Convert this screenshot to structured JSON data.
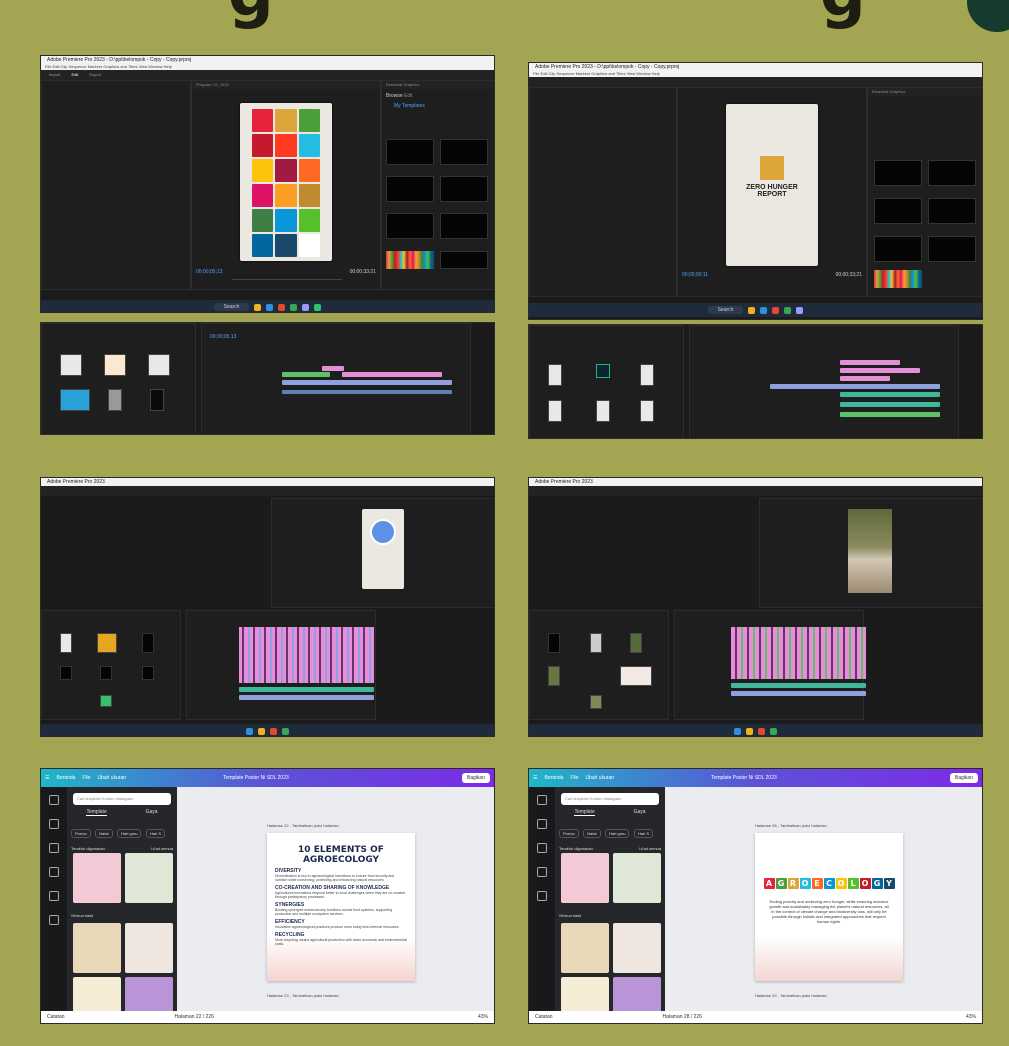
{
  "background": {
    "color": "#a4a552",
    "top_glyph": "g"
  },
  "premiere_top_left": {
    "window_title": "Adobe Premiere Pro 2023 - D:\\ppt\\kelompok - Copy - Copy.prproj",
    "menu": "File  Edit  Clip  Sequence  Markers  Graphics and Titles  View  Window  Help",
    "workspace_tabs": [
      "Import",
      "Edit",
      "Export"
    ],
    "program_label": "Program: 01_SDG",
    "timecode_left": "00;00;05;13",
    "timecode_right": "00;00;33;21",
    "essential_graphics": "Essential Graphics",
    "browse_tab": "Browse",
    "edit_tab": "Edit",
    "my_templates": "My Templates",
    "poster_colors": [
      "#e5243b",
      "#dda63a",
      "#4c9f38",
      "#c5192d",
      "#ff3a21",
      "#26bde2",
      "#fcc30b",
      "#a21942",
      "#fd6925",
      "#dd1367",
      "#fd9d24",
      "#bf8b2e",
      "#3f7e44",
      "#0a97d9",
      "#56c02b",
      "#00689d",
      "#19486a",
      "#ffffff"
    ]
  },
  "premiere_top_right": {
    "window_title": "Adobe Premiere Pro 2023 - D:\\ppt\\kelompok - Copy - Copy.prproj",
    "poster_line1": "ZERO HUNGER",
    "poster_line2": "REPORT",
    "timecode_left": "00;00;00;11",
    "timecode_right": "00;00;33;21",
    "essential_graphics": "Essential Graphics"
  },
  "premiere_mid_left": {
    "window_title": "Adobe Premiere Pro 2023"
  },
  "premiere_mid_right": {
    "window_title": "Adobe Premiere Pro 2023"
  },
  "taskbar": {
    "search": "Search"
  },
  "canva_left": {
    "top_items": [
      "Beranda",
      "File",
      "Ubah ukuran"
    ],
    "doc_title": "Template Poster Ni SDL 2023",
    "present_button": "Bagikan",
    "search_placeholder": "Cari template Konten Instagram",
    "tabs": [
      "Template",
      "Gaya"
    ],
    "chips": [
      "Promo",
      "Natal",
      "Hari guru",
      "Hari S"
    ],
    "section_1": "Terakhir digunakan",
    "section_1_link": "Lihat semua",
    "section_2": "Semua hasil",
    "page_label": "Halaman 22 - Tambahkan judul halaman",
    "page_label_next": "Halaman 23 - Tambahkan judul halaman",
    "slide_title": "10 ELEMENTS OF AGROECOLOGY",
    "sections": [
      {
        "h": "DIVERSITY",
        "p": "Diversification is key to agroecological transitions to ensure food security and nutrition while conserving, protecting and enhancing natural resources."
      },
      {
        "h": "CO-CREATION AND SHARING OF KNOWLEDGE",
        "p": "Agricultural innovations respond better to local challenges when they are co-created through participatory processes."
      },
      {
        "h": "SYNERGIES",
        "p": "Building synergies enhances key functions across food systems, supporting production and multiple ecosystem services."
      },
      {
        "h": "EFFICIENCY",
        "p": "Innovative agroecological practices produce more using less external resources."
      },
      {
        "h": "RECYCLING",
        "p": "More recycling means agricultural production with lower economic and environmental costs."
      }
    ],
    "notes": "Catatan",
    "page_counter": "Halaman 22 / 226",
    "zoom": "43%"
  },
  "canva_right": {
    "doc_title": "Template Poster Ni SDL 2023",
    "present_button": "Bagikan",
    "page_label": "Halaman 28 - Tambahkan judul halaman",
    "page_label_next": "Halaman 29 - Tambahkan judul halaman",
    "word_blocks": [
      "A",
      "G",
      "R",
      "O",
      "E",
      "C",
      "O",
      "L",
      "O",
      "G",
      "Y"
    ],
    "block_colors": [
      "#e5243b",
      "#4c9f38",
      "#dda63a",
      "#26bde2",
      "#fd6925",
      "#0a97d9",
      "#fcc30b",
      "#56c02b",
      "#c5192d",
      "#00689d",
      "#19486a"
    ],
    "body_text": "Ending poverty and achieving zero hunger, while ensuring inclusive growth and sustainably managing the planet's natural resources, all in the context of climate change and biodiversity loss, will only be possible through holistic and integrated approaches that respect human rights.",
    "notes": "Catatan",
    "page_counter": "Halaman 28 / 226",
    "zoom": "43%"
  }
}
